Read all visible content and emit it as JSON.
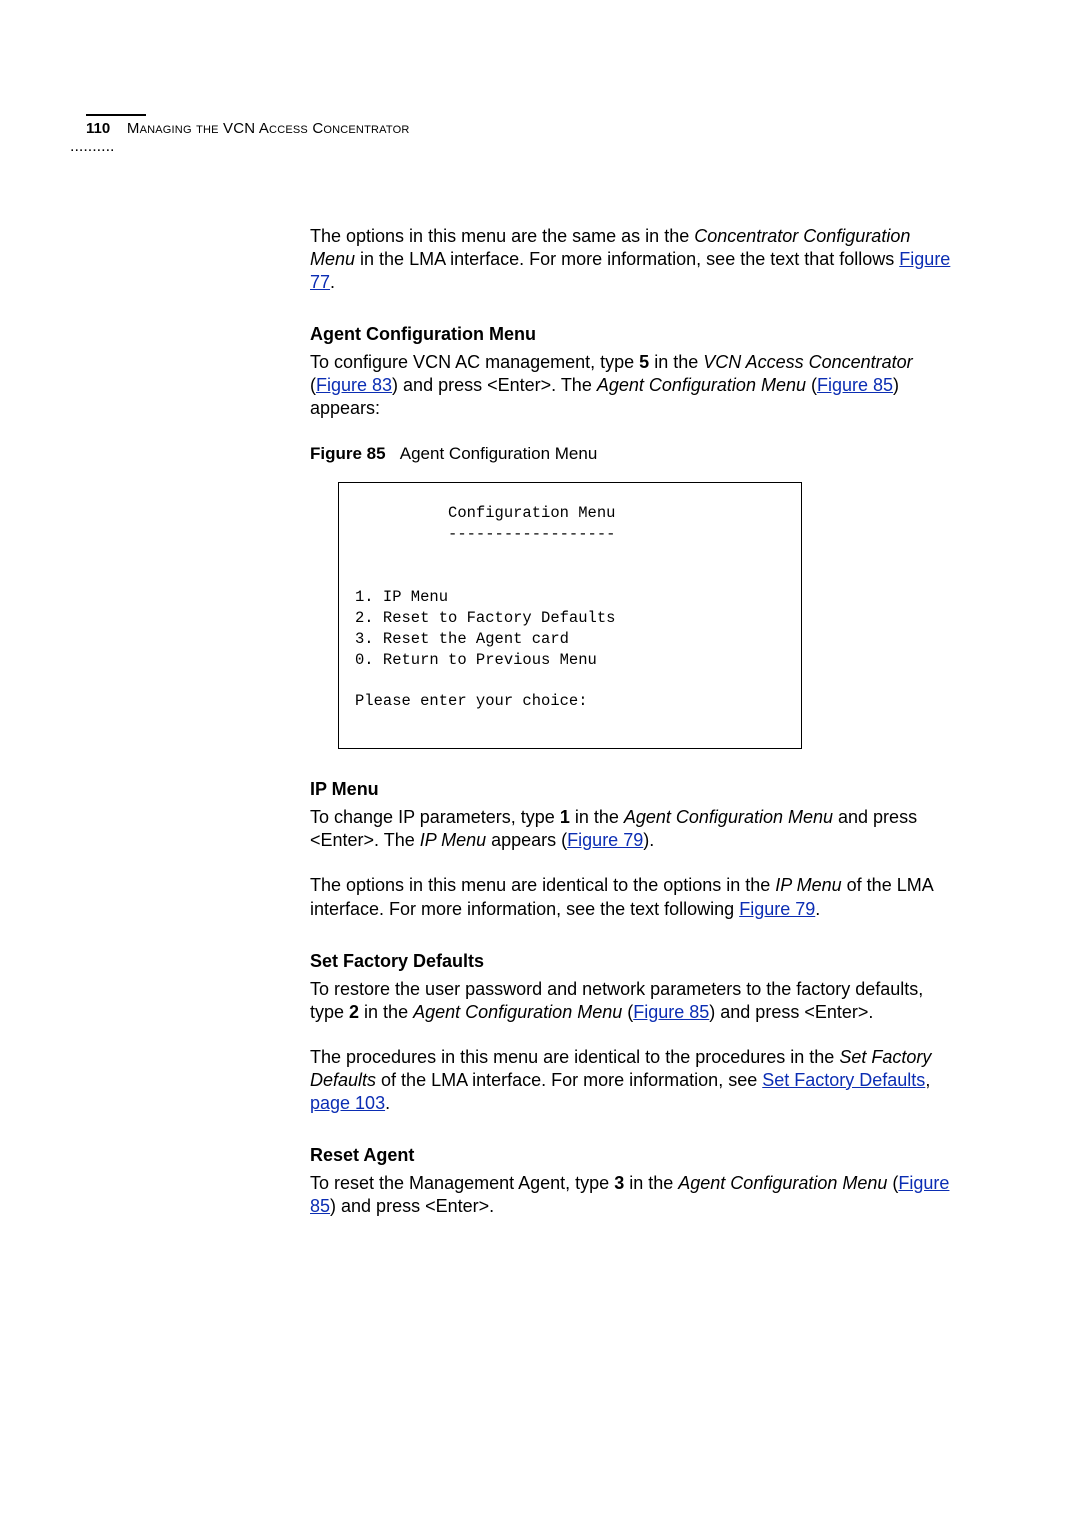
{
  "header": {
    "pagenum": "110",
    "title": "Managing the VCN Access Concentrator"
  },
  "intro": {
    "p1a": "The options in this menu are the same as in the ",
    "p1b": "Concentrator Configuration Menu",
    "p1c": " in the LMA interface. For more information, see the text that follows ",
    "link1": "Figure 77",
    "p1d": "."
  },
  "agent": {
    "heading": "Agent Configuration Menu",
    "p1a": "To configure VCN AC management, type ",
    "p1key": "5",
    "p1b": " in the ",
    "p1c": "VCN Access Concentrator",
    "p1d": " (",
    "link1": "Figure 83",
    "p1e": ") and press <Enter>. The ",
    "p1f": "Agent Configuration Menu",
    "p1g": " (",
    "link2": "Figure 85",
    "p1h": ") appears:"
  },
  "figure85": {
    "label": "Figure 85",
    "caption": "Agent Configuration Menu",
    "code": "          Configuration Menu\n          ------------------\n\n\n1. IP Menu\n2. Reset to Factory Defaults\n3. Reset the Agent card\n0. Return to Previous Menu\n\nPlease enter your choice:"
  },
  "ipmenu": {
    "heading": "IP Menu",
    "p1a": "To change IP parameters, type ",
    "p1key": "1",
    "p1b": " in the ",
    "p1c": "Agent Configuration Menu",
    "p1d": " and press <Enter>. The ",
    "p1e": "IP Menu",
    "p1f": " appears (",
    "link1": "Figure 79",
    "p1g": ").",
    "p2a": "The options in this menu are identical to the options in the ",
    "p2b": "IP Menu",
    "p2c": " of the LMA interface. For more information, see the text following ",
    "link2": "Figure 79",
    "p2d": "."
  },
  "factory": {
    "heading": "Set Factory Defaults",
    "p1a": "To restore the user password and network parameters to the factory defaults, type ",
    "p1key": "2",
    "p1b": " in the ",
    "p1c": "Agent Configuration Menu",
    "p1d": " (",
    "link1": "Figure 85",
    "p1e": ") and press <Enter>.",
    "p2a": "The procedures in this menu are identical to the procedures in the ",
    "p2b": "Set Factory Defaults",
    "p2c": " of the LMA interface. For more information, see ",
    "link2": "Set Factory Defaults",
    "p2d": ", ",
    "link3": "page 103",
    "p2e": "."
  },
  "reset": {
    "heading": "Reset Agent",
    "p1a": "To reset the Management Agent, type ",
    "p1key": "3",
    "p1b": " in the ",
    "p1c": "Agent Configuration Menu",
    "p1d": " (",
    "link1": "Figure 85",
    "p1e": ") and press <Enter>."
  }
}
